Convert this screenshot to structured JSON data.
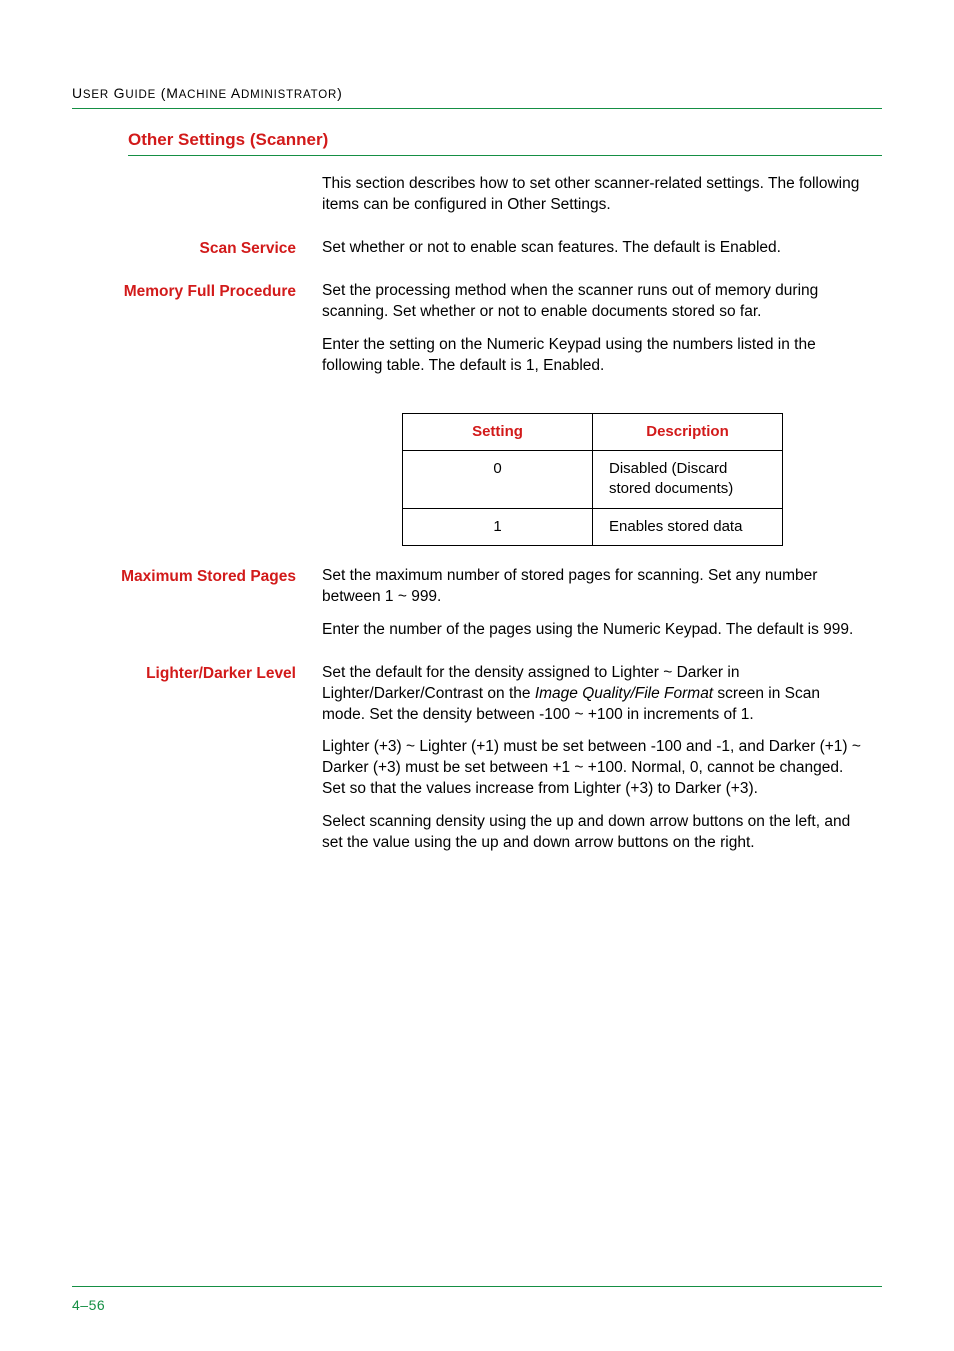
{
  "header": {
    "running_head_caps": "U",
    "running_head_rest": "SER",
    "running_head_word2_caps": "G",
    "running_head_word2_rest": "UIDE",
    "running_head_paren_open": " (",
    "running_head_word3_caps": "M",
    "running_head_word3_rest": "ACHINE",
    "running_head_word4_caps": "A",
    "running_head_word4_rest": "DMINISTRATOR",
    "running_head_paren_close": ")"
  },
  "section": {
    "title": "Other Settings (Scanner)",
    "intro": "This section describes how to set other scanner-related settings. The following items can be configured in Other Settings."
  },
  "scan_service": {
    "label": "Scan Service",
    "text": "Set whether or not to enable scan features. The default is Enabled."
  },
  "memory_full": {
    "label": "Memory Full Procedure",
    "p1": "Set the processing method when the scanner runs out of memory during scanning.  Set whether or not to enable documents stored so far.",
    "p2": "Enter the setting on the Numeric Keypad using the numbers listed in the following table. The default is 1, Enabled."
  },
  "table": {
    "head_setting": "Setting",
    "head_description": "Description",
    "rows": [
      {
        "setting": "0",
        "description": "Disabled (Discard stored documents)"
      },
      {
        "setting": "1",
        "description": "Enables stored data"
      }
    ]
  },
  "max_pages": {
    "label": "Maximum Stored Pages",
    "p1": "Set the maximum number of stored pages for scanning. Set any number between 1 ~ 999.",
    "p2": "Enter the number of the pages using the Numeric Keypad. The default is 999."
  },
  "lighter_darker": {
    "label": "Lighter/Darker Level",
    "p1a": "Set the default for the density assigned to Lighter ~ Darker in Lighter/Darker/Contrast on the ",
    "p1_italic": "Image Quality/File Format",
    "p1b": " screen in Scan mode. Set the density between -100 ~ +100 in increments of 1.",
    "p2": "Lighter (+3) ~ Lighter (+1) must be set between -100 and -1, and Darker (+1) ~ Darker (+3) must be set between +1 ~ +100. Normal, 0, cannot be changed.  Set so that the values increase from Lighter (+3) to Darker (+3).",
    "p3": "Select scanning density using the up and down arrow buttons on the left, and set the value using the up and down arrow buttons on the right."
  },
  "footer": {
    "page_number": "4–56"
  }
}
